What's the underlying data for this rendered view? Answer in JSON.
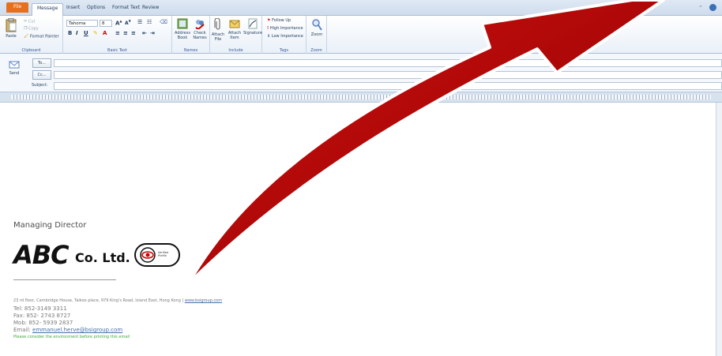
{
  "tabs": [
    "File",
    "Message",
    "Insert",
    "Options",
    "Format Text",
    "Review"
  ],
  "ribbon": {
    "clipboard": {
      "paste": "Paste",
      "cut": "Cut",
      "copy": "Copy",
      "format_painter": "Format Painter",
      "label": "Clipboard"
    },
    "basic_text": {
      "font": "Tahoma",
      "size": "8",
      "label": "Basic Text"
    },
    "names": {
      "address_book": "Address Book",
      "check_names": "Check Names",
      "label": "Names"
    },
    "include": {
      "attach_file": "Attach File",
      "attach_item": "Attach Item",
      "signature": "Signature",
      "label": "Include"
    },
    "tags": {
      "follow_up": "Follow Up",
      "high": "High Importance",
      "low": "Low Importance",
      "label": "Tags"
    },
    "zoom": {
      "zoom": "Zoom",
      "label": "Zoom"
    }
  },
  "header": {
    "send": "Send",
    "to": "To...",
    "cc": "Cc...",
    "subject": "Subject:"
  },
  "signature": {
    "title": "Managing Director",
    "logo_abc": "ABC",
    "logo_co": "Co. Ltd.",
    "badge": "Verified Profile",
    "address": "23 rd floor, Cambridge House, Taikoo place, 979 King's Road, Island East, Hong Kong |",
    "website": "www.bsigroup.com",
    "tel": "Tel:   852-3149 3311",
    "fax": "Fax:  852- 2743 8727",
    "mob": "Mob: 852- 5939 2837",
    "email_label": "Email:",
    "email": "emmanuel.herve@bsigroup.com",
    "env": "Please consider the environment before printing this email"
  },
  "colors": {
    "arrow": "#b00000",
    "file_tab": "#e8701a",
    "env_text": "#3caa3c"
  }
}
